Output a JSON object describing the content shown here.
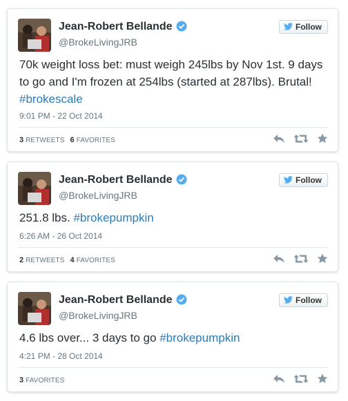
{
  "colors": {
    "hashtag": "#2b7bb9",
    "text": "#292f33",
    "muted": "#66757f",
    "verified": "#55acee"
  },
  "tweets": [
    {
      "name": "Jean-Robert Bellande",
      "handle": "@BrokeLivingJRB",
      "follow_label": "Follow",
      "text": "70k weight loss bet: must weigh 245lbs by Nov 1st.  9 days to go and I'm frozen at 254lbs (started at 287lbs). Brutal! ",
      "hashtag": "#brokescale",
      "timestamp": "9:01 PM - 22 Oct 2014",
      "retweets_count": "3",
      "retweets_label": "RETWEETS",
      "favorites_count": "6",
      "favorites_label": "FAVORITES"
    },
    {
      "name": "Jean-Robert Bellande",
      "handle": "@BrokeLivingJRB",
      "follow_label": "Follow",
      "text": "251.8 lbs. ",
      "hashtag": "#brokepumpkin",
      "timestamp": "6:26 AM - 26 Oct 2014",
      "retweets_count": "2",
      "retweets_label": "RETWEETS",
      "favorites_count": "4",
      "favorites_label": "FAVORITES"
    },
    {
      "name": "Jean-Robert Bellande",
      "handle": "@BrokeLivingJRB",
      "follow_label": "Follow",
      "text": "4.6 lbs over... 3 days to go ",
      "hashtag": "#brokepumpkin",
      "timestamp": "4:21 PM - 28 Oct 2014",
      "favorites_count": "3",
      "favorites_label": "FAVORITES"
    }
  ],
  "icons": [
    "reply-icon",
    "retweet-icon",
    "favorite-icon",
    "twitter-bird-icon",
    "verified-icon"
  ]
}
